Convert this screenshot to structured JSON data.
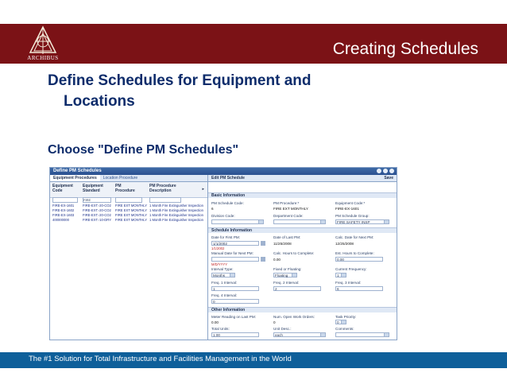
{
  "slide": {
    "title": "Creating Schedules",
    "logo_text": "ARCHIBUS",
    "heading_line1": "Define Schedules for Equipment and",
    "heading_line2": "Locations",
    "subheading": "Choose \"Define PM Schedules\"",
    "footer": "The #1 Solution for Total Infrastructure and Facilities Management in the World",
    "colors": {
      "top_band": "#7b1216",
      "footer_band": "#0e5f9a",
      "heading": "#0e2c6b"
    }
  },
  "app": {
    "window_title": "Define PM Schedules",
    "window_buttons": [
      "refresh-icon",
      "minimize-icon",
      "close-icon"
    ],
    "tabs": [
      "Equipment Procedures",
      "Location Procedure"
    ],
    "columns": [
      "Equipment Code",
      "Equipment Standard",
      "PM Procedure",
      "PM Procedure Description"
    ],
    "filter_value": "FIRE",
    "rows": [
      [
        "FIRE-EX-1601",
        "FIRE-EXT.-20-CO2",
        "FIRE EXT MONTHLY",
        "1 Month Fire Extinguisher Inspection"
      ],
      [
        "FIRE-EX-1602",
        "FIRE-EXT.-20-CO2",
        "FIRE EXT MONTHLY",
        "1 Month Fire Extinguisher Inspection"
      ],
      [
        "FIRE-EX-1603",
        "FIRE-EXT.-20-CO2",
        "FIRE EXT MONTHLY",
        "1 Month Fire Extinguisher Inspection"
      ],
      [
        "400000000",
        "FIRE-EXT.-10-DRY",
        "FIRE EXT MONTHLY",
        "1 Month Fire Extinguisher Inspection"
      ]
    ],
    "edit": {
      "title": "Edit PM Schedule",
      "save": "Save",
      "basic_section": "Basic Information",
      "pm_schedule_code_label": "PM Schedule Code:",
      "pm_schedule_code": "6",
      "pm_procedure_label": "PM Procedure:*",
      "pm_procedure": "FIRE EXT MONTHLY",
      "equipment_code_label": "Equipment Code:*",
      "equipment_code": "FIRE-EX-1601",
      "division_code_label": "Division Code:",
      "department_code_label": "Department Code:",
      "pm_schedule_group_label": "PM Schedule Group:",
      "pm_schedule_group": "FIRE SAFETY INSP",
      "schedule_section": "Schedule Information",
      "date_first_pm_label": "Date for First PM:",
      "date_first_pm": "1/1/2002",
      "date_first_pm_hint": "1/1/2002",
      "date_last_pm_label": "Date of Last PM:",
      "date_last_pm": "11/25/2008",
      "calc_date_next_pm_label": "Calc. Date for Next PM:",
      "calc_date_next_pm": "12/25/2008",
      "manual_date_next_pm_label": "Manual Date for Next PM:",
      "date_format_hint": "M/D/YYYY",
      "calc_hours_label": "Calc. Hours to Complete:",
      "calc_hours": "0.00",
      "est_hours_label": "Est. Hours to Complete:",
      "est_hours": "0.00",
      "interval_type_label": "Interval Type:",
      "interval_type": "Months",
      "fixed_floating_label": "Fixed or Floating:",
      "fixed_floating": "Floating",
      "current_frequency_label": "Current Frequency:",
      "current_frequency": "1",
      "freq1_label": "Freq. 1 Interval:",
      "freq1": "1",
      "freq2_label": "Freq. 2 Interval:",
      "freq2": "2",
      "freq3_label": "Freq. 3 Interval:",
      "freq3": "6",
      "freq4_label": "Freq. 4 Interval:",
      "freq4": "0",
      "other_section": "Other Information",
      "meter_reading_label": "Meter Reading on Last PM:",
      "meter_reading": "0.00",
      "num_open_wo_label": "Num. Open Work Orders:",
      "num_open_wo": "0",
      "task_priority_label": "Task Priority:",
      "task_priority": "0",
      "total_units_label": "Total Units:",
      "total_units": "1.00",
      "unit_desc_label": "Unit Desc.:",
      "unit_desc": "each",
      "comments_label": "Comments:"
    }
  }
}
